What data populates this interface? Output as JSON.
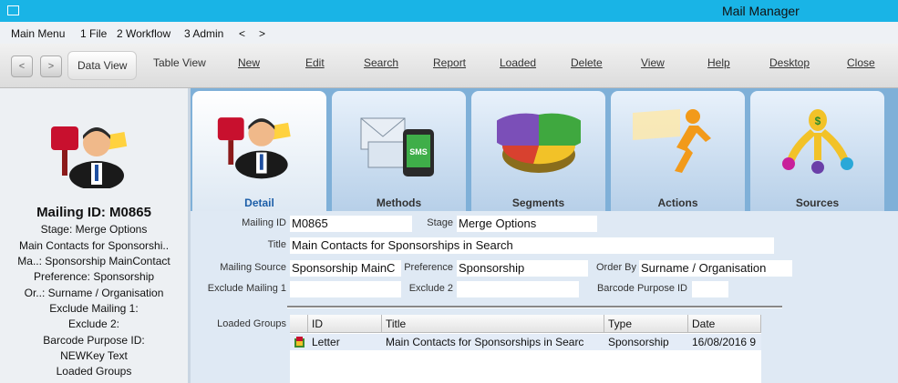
{
  "window": {
    "title": "Mail Manager"
  },
  "menu": [
    "Main Menu",
    "1 File",
    "2 Workflow",
    "3 Admin",
    "<",
    ">"
  ],
  "toolbar": {
    "back": "<",
    "forward": ">",
    "buttons": [
      "Data View",
      "Table View",
      "New",
      "Edit",
      "Search",
      "Report",
      "Loaded",
      "Delete",
      "View",
      "Help",
      "Desktop",
      "Close"
    ]
  },
  "left": {
    "mailing_id": "Mailing ID: M0865",
    "lines": [
      "Stage: Merge Options",
      "Main Contacts for Sponsorshi..",
      "Ma..: Sponsorship MainContact",
      "Preference: Sponsorship",
      "Or..: Surname / Organisation",
      "Exclude Mailing 1:",
      "Exclude 2:",
      "Barcode Purpose ID:",
      "NEWKey  Text",
      "Loaded Groups"
    ]
  },
  "tabs": [
    "Detail",
    "Methods",
    "Segments",
    "Actions",
    "Sources"
  ],
  "form": {
    "mailing_id_label": "Mailing ID",
    "mailing_id": "M0865",
    "stage_label": "Stage",
    "stage": "Merge Options",
    "title_label": "Title",
    "title": "Main Contacts for Sponsorships in Search",
    "source_label": "Mailing Source",
    "source": "Sponsorship MainC",
    "preference_label": "Preference",
    "preference": "Sponsorship",
    "orderby_label": "Order By",
    "orderby": "Surname / Organisation",
    "exclude1_label": "Exclude Mailing 1",
    "exclude1": "",
    "exclude2_label": "Exclude 2",
    "exclude2": "",
    "barcode_label": "Barcode Purpose ID",
    "barcode": ""
  },
  "groups": {
    "label": "Loaded Groups",
    "columns": [
      "ID",
      "Title",
      "Type",
      "Date"
    ],
    "rows": [
      [
        "Letter",
        "Main Contacts for Sponsorships in Searc",
        "Sponsorship",
        "16/08/2016 9"
      ]
    ]
  }
}
